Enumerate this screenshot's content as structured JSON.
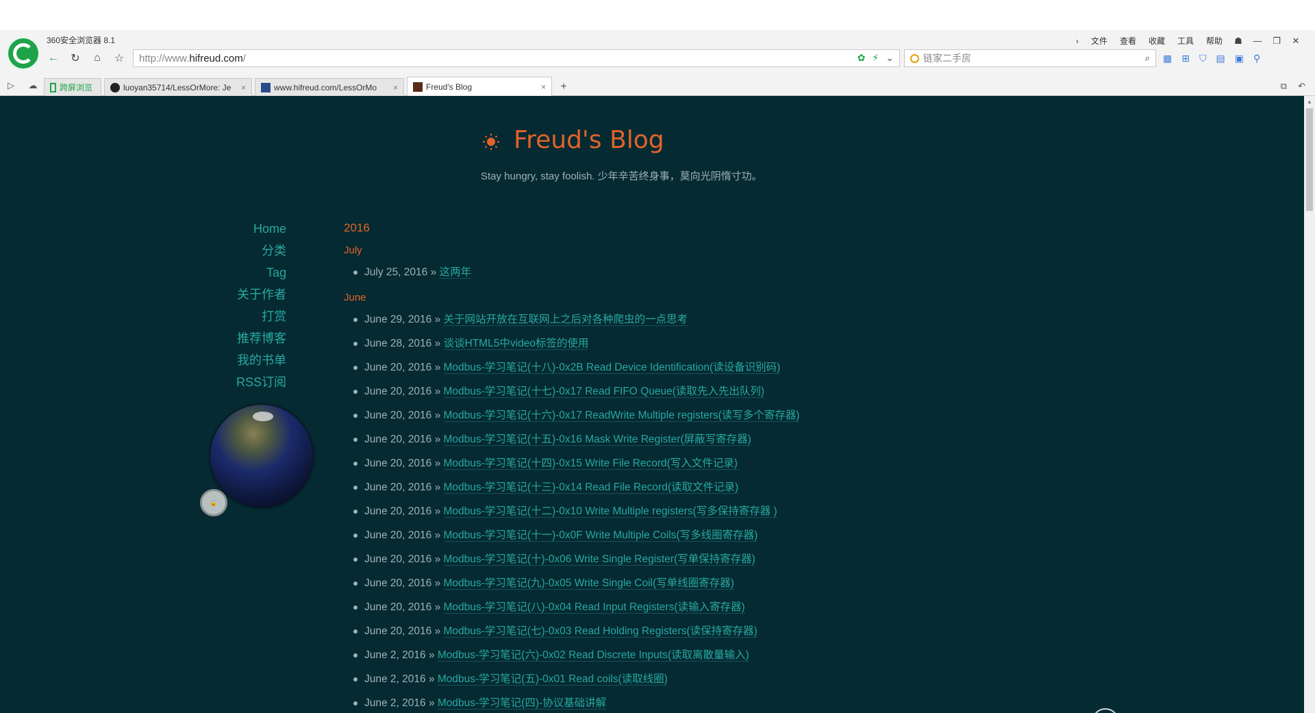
{
  "browser": {
    "app_title": "360安全浏览器 8.1",
    "menu": [
      "文件",
      "查看",
      "收藏",
      "工具",
      "帮助"
    ],
    "url_prefix": "http://www.",
    "url_host": "hifreud.com",
    "url_suffix": "/",
    "search_placeholder": "链家二手房",
    "tabs": [
      {
        "label": "跨屏浏览"
      },
      {
        "label": "luoyan35714/LessOrMore: Je"
      },
      {
        "label": "www.hifreud.com/LessOrMo"
      },
      {
        "label": "Freud's Blog"
      }
    ]
  },
  "blog": {
    "title": "Freud's Blog",
    "subtitle": "Stay hungry, stay foolish. 少年辛苦终身事，莫向光阴惰寸功。",
    "nav": [
      "Home",
      "分类",
      "Tag",
      "关于作者",
      "打赏",
      "推荐博客",
      "我的书单",
      "RSS订阅"
    ],
    "year": "2016",
    "months": [
      {
        "name": "July",
        "posts": [
          {
            "date": "July 25, 2016",
            "title": "这两年"
          }
        ]
      },
      {
        "name": "June",
        "posts": [
          {
            "date": "June 29, 2016",
            "title": "关于网站开放在互联网上之后对各种爬虫的一点思考"
          },
          {
            "date": "June 28, 2016",
            "title": "谈谈HTML5中video标签的使用"
          },
          {
            "date": "June 20, 2016",
            "title": "Modbus-学习笔记(十八)-0x2B Read Device Identification(读设备识别码)"
          },
          {
            "date": "June 20, 2016",
            "title": "Modbus-学习笔记(十七)-0x17 Read FIFO Queue(读取先入先出队列)"
          },
          {
            "date": "June 20, 2016",
            "title": "Modbus-学习笔记(十六)-0x17 ReadWrite Multiple registers(读写多个寄存器)"
          },
          {
            "date": "June 20, 2016",
            "title": "Modbus-学习笔记(十五)-0x16 Mask Write Register(屏蔽写寄存器)"
          },
          {
            "date": "June 20, 2016",
            "title": "Modbus-学习笔记(十四)-0x15 Write File Record(写入文件记录)"
          },
          {
            "date": "June 20, 2016",
            "title": "Modbus-学习笔记(十三)-0x14 Read File Record(读取文件记录)"
          },
          {
            "date": "June 20, 2016",
            "title": "Modbus-学习笔记(十二)-0x10 Write Multiple registers(写多保持寄存器 )"
          },
          {
            "date": "June 20, 2016",
            "title": "Modbus-学习笔记(十一)-0x0F Write Multiple Coils(写多线圈寄存器)"
          },
          {
            "date": "June 20, 2016",
            "title": "Modbus-学习笔记(十)-0x06 Write Single Register(写单保持寄存器)"
          },
          {
            "date": "June 20, 2016",
            "title": "Modbus-学习笔记(九)-0x05 Write Single Coil(写单线圈寄存器)"
          },
          {
            "date": "June 20, 2016",
            "title": "Modbus-学习笔记(八)-0x04 Read Input Registers(读输入寄存器)"
          },
          {
            "date": "June 20, 2016",
            "title": "Modbus-学习笔记(七)-0x03 Read Holding Registers(读保持寄存器)"
          },
          {
            "date": "June 2, 2016",
            "title": "Modbus-学习笔记(六)-0x02 Read Discrete Inputs(读取离散量输入)"
          },
          {
            "date": "June 2, 2016",
            "title": "Modbus-学习笔记(五)-0x01 Read coils(读取线圈)"
          },
          {
            "date": "June 2, 2016",
            "title": "Modbus-学习笔记(四)-协议基础讲解"
          }
        ]
      }
    ]
  },
  "colors": {
    "page_bg": "#052a32",
    "accent": "#e2632a",
    "link": "#28a8a0",
    "text": "#9eb3b5"
  }
}
